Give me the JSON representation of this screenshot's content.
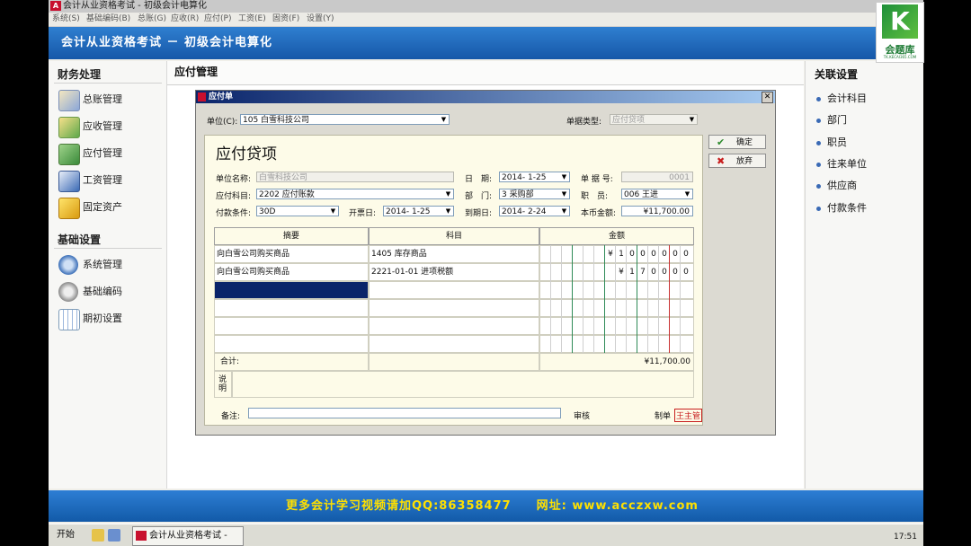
{
  "window": {
    "title": "会计从业资格考试 - 初级会计电算化"
  },
  "menu": [
    "系统(S)",
    "基础编码(B)",
    "总账(G)",
    "应收(R)",
    "应付(P)",
    "工资(E)",
    "固资(F)",
    "设置(Y)"
  ],
  "banner": {
    "title": "会计从业资格考试 － 初级会计电算化"
  },
  "logo": {
    "letter": "K",
    "text": "会题库",
    "sub": "TK.KECAI365.COM"
  },
  "left": {
    "finance_title": "财务处理",
    "finance_items": [
      {
        "label": "总账管理",
        "icon": "ledger-icon"
      },
      {
        "label": "应收管理",
        "icon": "receivable-icon"
      },
      {
        "label": "应付管理",
        "icon": "payable-icon"
      },
      {
        "label": "工资管理",
        "icon": "payroll-icon"
      },
      {
        "label": "固定资产",
        "icon": "fixed-assets-icon"
      }
    ],
    "basic_title": "基础设置",
    "basic_items": [
      {
        "label": "系统管理",
        "icon": "system-gear-icon"
      },
      {
        "label": "基础编码",
        "icon": "basic-code-gear-icon"
      },
      {
        "label": "期初设置",
        "icon": "opening-settings-icon"
      }
    ]
  },
  "main": {
    "title": "应付管理"
  },
  "right": {
    "title": "关联设置",
    "items": [
      "会计科目",
      "部门",
      "职员",
      "往来单位",
      "供应商",
      "付款条件"
    ]
  },
  "dialog": {
    "title": "应付单",
    "unit_label": "单位(C):",
    "unit_value": "105 白雪科技公司",
    "doc_type_label": "单据类型:",
    "doc_type_value": "应付贷项",
    "voucher_title": "应付贷项",
    "ok_label": "确定",
    "cancel_label": "放弃",
    "fields": {
      "unit_name_label": "单位名称:",
      "unit_name_value": "白雪科技公司",
      "date_label": "日　期:",
      "date_value": "2014- 1-25",
      "doc_no_label": "单 据 号:",
      "doc_no_value": "0001",
      "account_label": "应付科目:",
      "account_value": "2202 应付账款",
      "dept_label": "部　门:",
      "dept_value": "3 采购部",
      "staff_label": "职　员:",
      "staff_value": "006 王进",
      "terms_label": "付款条件:",
      "terms_value": "30D",
      "invoice_date_label": "开票日:",
      "invoice_date_value": "2014- 1-25",
      "due_date_label": "到期日:",
      "due_date_value": "2014- 2-24",
      "amount_label": "本币金额:",
      "amount_value": "¥11,700.00"
    },
    "table": {
      "headers": [
        "摘要",
        "科目",
        "金额"
      ],
      "rows": [
        {
          "summary": "向白雪公司购买商品",
          "account": "1405 库存商品",
          "digits": [
            "¥",
            "1",
            "0",
            "0",
            "0",
            "0",
            "0",
            "0"
          ]
        },
        {
          "summary": "向白雪公司购买商品",
          "account": "2221-01-01 进项税额",
          "digits": [
            "",
            "¥",
            "1",
            "7",
            "0",
            "0",
            "0",
            "0"
          ]
        }
      ],
      "total_label": "合计:",
      "total_value": "¥11,700.00",
      "note_label": "说\n明"
    },
    "remark_label": "备注:",
    "audit_label": "审核",
    "maker_label": "制单",
    "maker_value": "王主管"
  },
  "bottom_banner": "更多会计学习视频请加QQ:86358477　　网址: www.acczxw.com",
  "taskbar": {
    "start": "开始",
    "task": "会计从业资格考试 - 初...",
    "clock": "17:51"
  }
}
